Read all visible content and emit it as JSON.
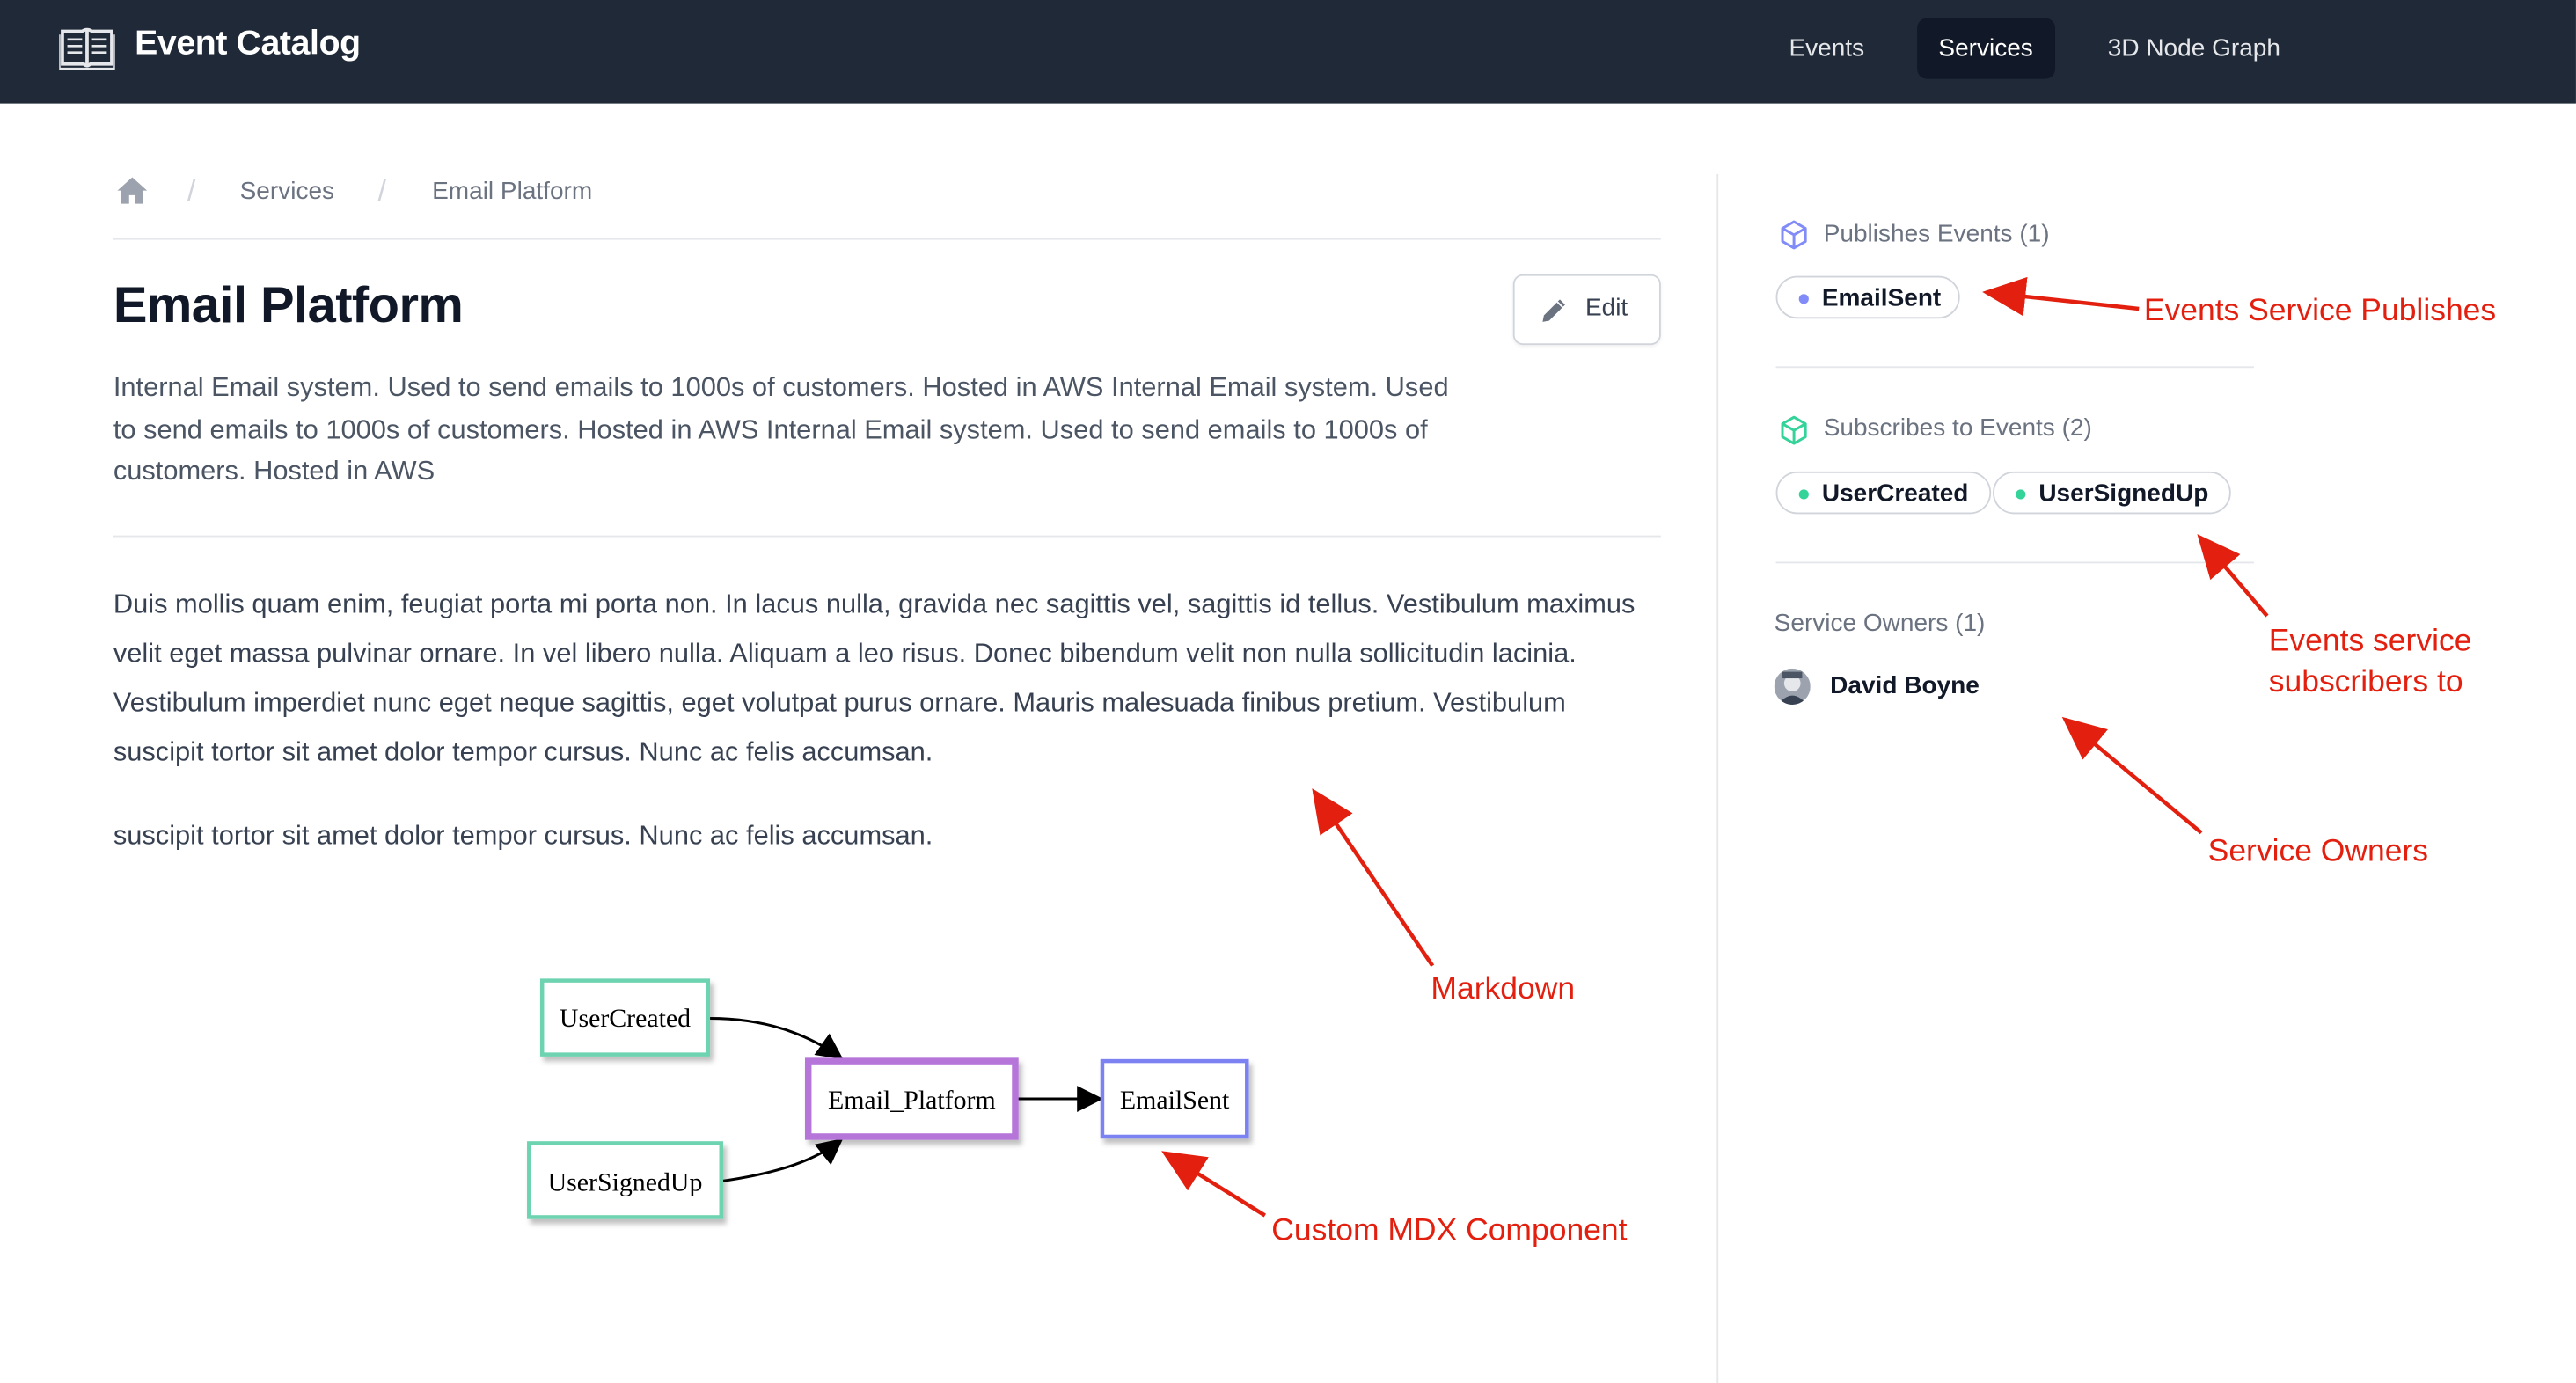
{
  "nav": {
    "brand": "Event Catalog",
    "items": [
      {
        "label": "Events",
        "active": false
      },
      {
        "label": "Services",
        "active": true
      },
      {
        "label": "3D Node Graph",
        "active": false
      }
    ]
  },
  "breadcrumb": {
    "home_icon": "home-icon",
    "items": [
      "Services",
      "Email Platform"
    ]
  },
  "main": {
    "title": "Email Platform",
    "edit_label": "Edit",
    "summary": "Internal Email system. Used to send emails to 1000s of customers. Hosted in AWS Internal Email system. Used to send emails to 1000s of customers. Hosted in AWS Internal Email system. Used to send emails to 1000s of customers. Hosted in AWS",
    "paragraph1": "Duis mollis quam enim, feugiat porta mi porta non. In lacus nulla, gravida nec sagittis vel, sagittis id tellus. Vestibulum maximus velit eget massa pulvinar ornare. In vel libero nulla. Aliquam a leo risus. Donec bibendum velit non nulla sollicitudin lacinia. Vestibulum imperdiet nunc eget neque sagittis, eget volutpat purus ornare. Mauris malesuada finibus pretium. Vestibulum suscipit tortor sit amet dolor tempor cursus. Nunc ac felis accumsan.",
    "paragraph2": "suscipit tortor sit amet dolor tempor cursus. Nunc ac felis accumsan."
  },
  "diagram": {
    "nodes": {
      "user_created": "UserCreated",
      "user_signed_up": "UserSignedUp",
      "service": "Email_Platform",
      "email_sent": "EmailSent"
    },
    "colors": {
      "subscribed": "#6ed3b0",
      "service": "#b675d9",
      "published": "#7c82f2"
    }
  },
  "sidebar": {
    "publishes": {
      "title": "Publishes Events (1)",
      "icon": "cube-icon",
      "color": "#818cf8",
      "events": [
        "EmailSent"
      ]
    },
    "subscribes": {
      "title": "Subscribes to Events (2)",
      "icon": "cube-icon",
      "color": "#34d399",
      "events": [
        "UserCreated",
        "UserSignedUp"
      ]
    },
    "owners": {
      "title": "Service Owners (1)",
      "people": [
        "David Boyne"
      ]
    }
  },
  "annotations": {
    "publishes": "Events Service Publishes",
    "subscribes_line1": "Events service",
    "subscribes_line2": "subscribers to",
    "owners": "Service Owners",
    "markdown": "Markdown",
    "mdx": "Custom MDX Component",
    "color": "#e3200f"
  }
}
